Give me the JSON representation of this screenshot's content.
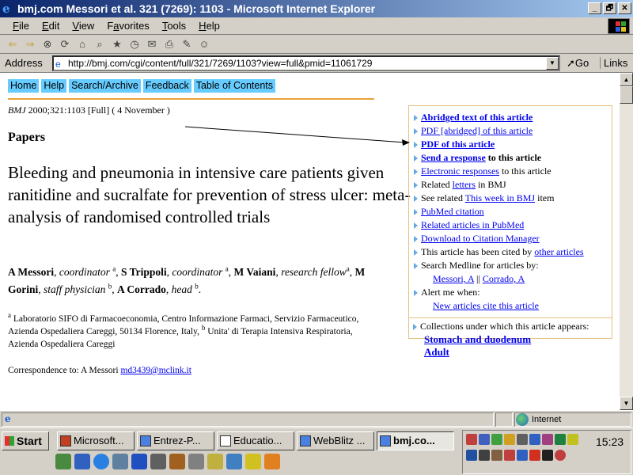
{
  "window": {
    "title": "bmj.com Messori et al. 321 (7269): 1103 - Microsoft Internet Explorer",
    "minimize": "_",
    "restore": "🗗",
    "close": "✕"
  },
  "menu": [
    "File",
    "Edit",
    "View",
    "Favorites",
    "Tools",
    "Help"
  ],
  "menu_mnemonics": [
    "F",
    "E",
    "V",
    "a",
    "T",
    "H"
  ],
  "toolbar_icons": [
    "back-icon",
    "forward-icon",
    "stop-icon",
    "refresh-icon",
    "home-icon",
    "search-icon",
    "favorites-icon",
    "history-icon",
    "mail-icon",
    "print-icon",
    "edit-icon",
    "messenger-icon"
  ],
  "address": {
    "label": "Address",
    "url": "http://bmj.com/cgi/content/full/321/7269/1103?view=full&pmid=11061729",
    "go": "Go",
    "links": "Links"
  },
  "nav": [
    "Home",
    "Help",
    "Search/Archive",
    "Feedback",
    "Table of Contents"
  ],
  "article": {
    "citation_journal": "BMJ",
    "citation_rest": " 2000;321:1103 [Full] ( 4 November )",
    "section": "Papers",
    "title": "Bleeding and pneumonia in intensive care patients given ranitidine and sucralfate for prevention of stress ulcer: meta-analysis of randomised controlled trials",
    "authors": [
      {
        "name": "A Messori",
        "role": "coordinator",
        "aff": "a"
      },
      {
        "name": "S Trippoli",
        "role": "coordinator",
        "aff": "a"
      },
      {
        "name": "M Vaiani",
        "role": "research fellow",
        "aff": "a"
      },
      {
        "name": "M Gorini",
        "role": "staff physician",
        "aff": "b"
      },
      {
        "name": "A Corrado",
        "role": "head",
        "aff": "b"
      }
    ],
    "affiliation_a_mark": "a",
    "affiliation_a": " Laboratorio SIFO di Farmacoeconomia, Centro Informazione Farmaci, Servizio Farmaceutico, Azienda Ospedaliera Careggi, 50134 Florence, Italy, ",
    "affiliation_b_mark": "b",
    "affiliation_b": " Unita' di Terapia Intensiva Respiratoria, Azienda Ospedaliera Careggi",
    "correspondence_label": "Correspondence to: A Messori ",
    "correspondence_email": "md3439@mclink.it"
  },
  "sidebar": {
    "abridged": "Abridged text of this article",
    "pdf_abridged": "PDF [abridged] of this article",
    "pdf": "PDF of this article",
    "send_response": "Send a response",
    "send_response_suffix": " to this article",
    "electronic_responses": "Electronic responses",
    "electronic_responses_suffix": " to this article",
    "related_prefix": "Related ",
    "related_link": "letters",
    "related_suffix": " in BMJ",
    "see_related_prefix": "See related ",
    "see_related_link": "This week in BMJ",
    "see_related_suffix": " item",
    "pubmed": "PubMed citation",
    "related_pubmed": "Related articles in PubMed",
    "download": "Download to Citation Manager",
    "cited_prefix": "This article has been cited by ",
    "cited_link": "other articles",
    "search_medline": "Search Medline for articles by:",
    "author_link_1": "Messori, A",
    "author_sep": " || ",
    "author_link_2": "Corrado, A",
    "alert": "Alert me when:",
    "alert_link": "New articles cite this article",
    "collections_label": "Collections under which this article appears:",
    "collections": [
      "Stomach and duodenum",
      "Adult"
    ]
  },
  "statusbar": {
    "zone": "Internet"
  },
  "taskbar": {
    "start": "Start",
    "tasks": [
      "Microsoft...",
      "Entrez-P...",
      "Educatio...",
      "WebBlitz ...",
      "bmj.co..."
    ],
    "active_task_index": 4,
    "clock": "15:23"
  },
  "colors": {
    "title_gradient_start": "#0a246a",
    "title_gradient_end": "#a6caf0",
    "nav_bg": "#66ccff",
    "rule": "#e8a33a",
    "sidebar_border": "#e8c080",
    "link": "#0000ee"
  }
}
